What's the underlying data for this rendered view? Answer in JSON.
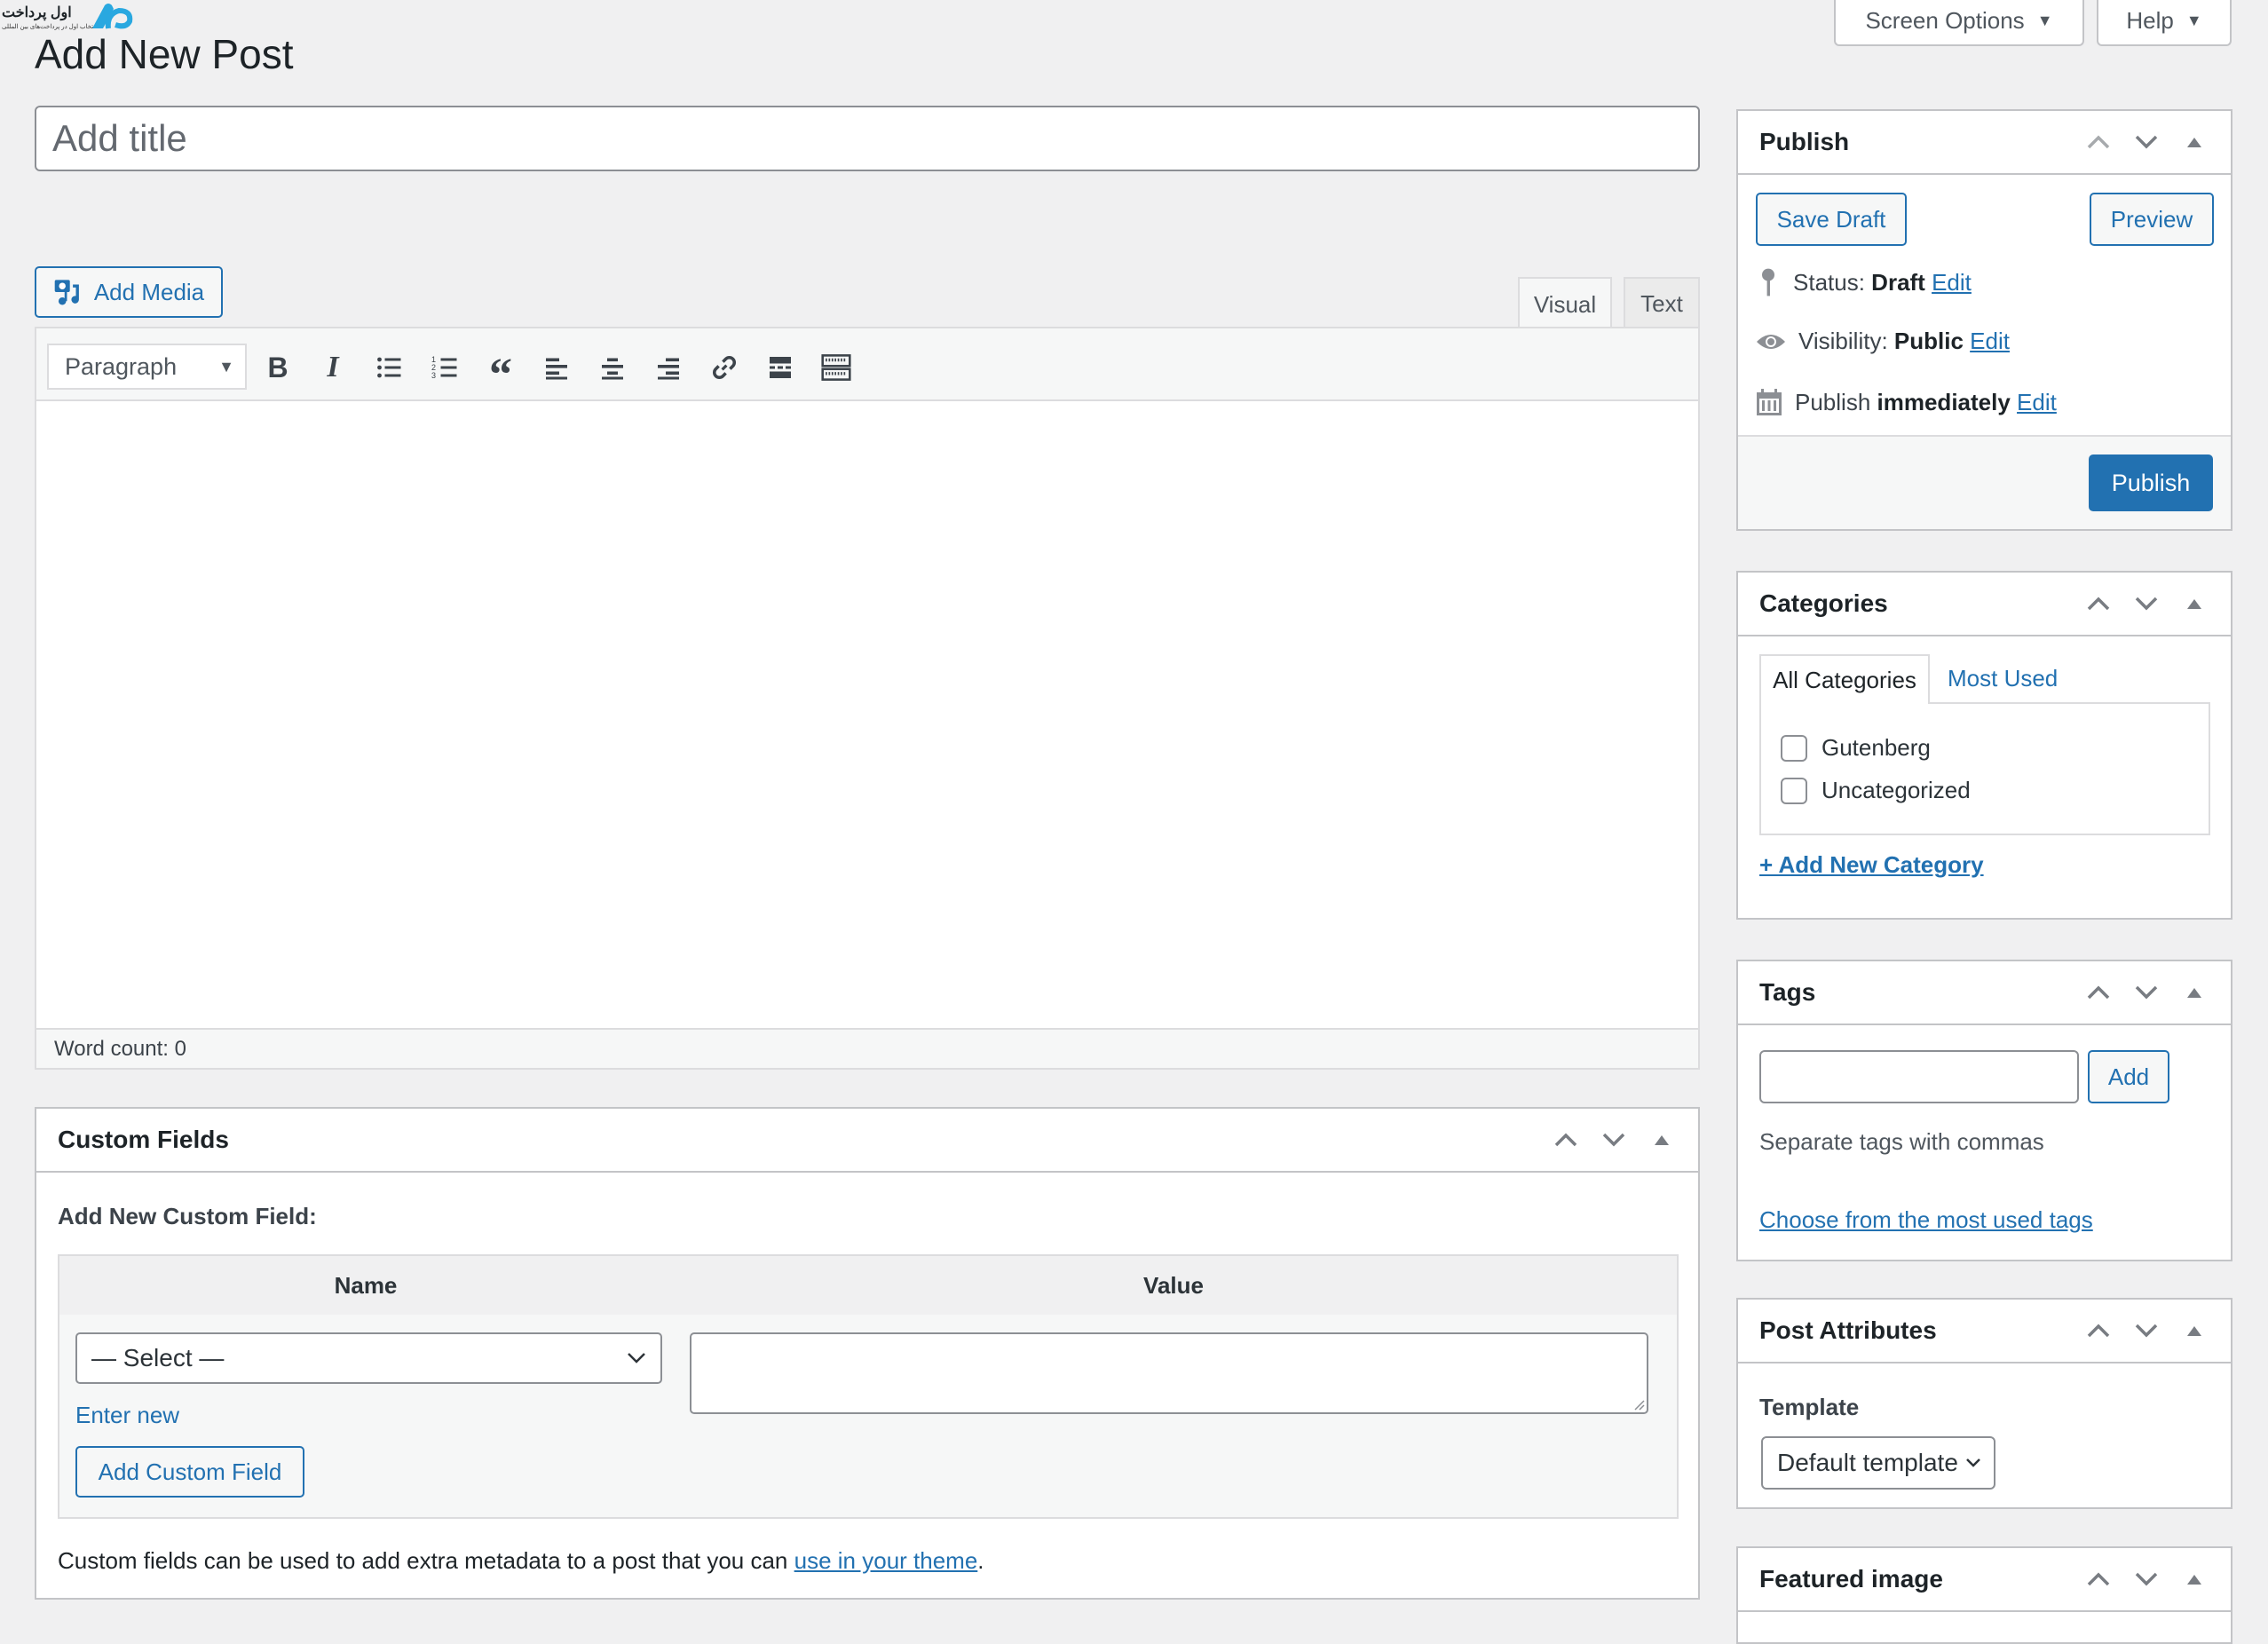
{
  "branding": {
    "logo_text": "اول پرداخت",
    "logo_subtext": "انتخاب اول در پرداخت‌های بین المللی"
  },
  "header": {
    "page_title": "Add New Post",
    "screen_options_label": "Screen Options",
    "help_label": "Help"
  },
  "editor": {
    "title_placeholder": "Add title",
    "title_value": "",
    "add_media_label": "Add Media",
    "tabs": [
      {
        "label": "Visual",
        "active": true
      },
      {
        "label": "Text",
        "active": false
      }
    ],
    "format_select": "Paragraph",
    "toolbar_icons": [
      "bold-icon",
      "italic-icon",
      "bulleted-list-icon",
      "numbered-list-icon",
      "blockquote-icon",
      "align-left-icon",
      "align-center-icon",
      "align-right-icon",
      "link-icon",
      "read-more-icon",
      "toolbar-toggle-icon"
    ],
    "word_count_label": "Word count: 0"
  },
  "custom_fields": {
    "title": "Custom Fields",
    "add_new_label": "Add New Custom Field:",
    "columns": [
      "Name",
      "Value"
    ],
    "name_select": "— Select —",
    "value": "",
    "enter_new_label": "Enter new",
    "add_button": "Add Custom Field",
    "help_text": "Custom fields can be used to add extra metadata to a post that you can ",
    "help_link": "use in your theme",
    "help_suffix": "."
  },
  "publish": {
    "title": "Publish",
    "save_draft": "Save Draft",
    "preview": "Preview",
    "status_label": "Status:",
    "status_value": "Draft",
    "visibility_label": "Visibility:",
    "visibility_value": "Public",
    "schedule_label": "Publish",
    "schedule_value": "immediately",
    "edit_label": "Edit",
    "publish_button": "Publish"
  },
  "categories": {
    "title": "Categories",
    "tabs": [
      {
        "label": "All Categories",
        "active": true
      },
      {
        "label": "Most Used",
        "active": false
      }
    ],
    "items": [
      {
        "label": "Gutenberg",
        "checked": false
      },
      {
        "label": "Uncategorized",
        "checked": false
      }
    ],
    "add_new": "+ Add New Category"
  },
  "tags": {
    "title": "Tags",
    "input_value": "",
    "add_button": "Add",
    "hint": "Separate tags with commas",
    "choose_link": "Choose from the most used tags"
  },
  "post_attributes": {
    "title": "Post Attributes",
    "template_label": "Template",
    "template_value": "Default template"
  },
  "featured_image": {
    "title": "Featured image"
  },
  "colors": {
    "accent": "#2271b1",
    "background": "#f0f0f1",
    "border": "#c3c4c7"
  }
}
